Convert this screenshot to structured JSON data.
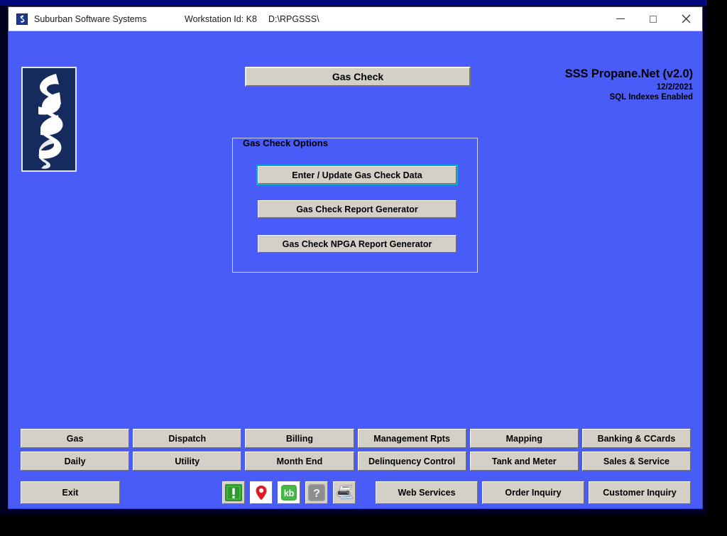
{
  "window": {
    "title": "Suburban Software Systems",
    "workstation": "Workstation Id: K8",
    "path": "D:\\RPGSSS\\",
    "controls": {
      "minimize": "minimize-button",
      "maximize": "maximize-button",
      "close": "close-button"
    }
  },
  "header": {
    "screen_title": "Gas Check",
    "app_name": "SSS Propane.Net (v2.0)",
    "date": "12/2/2021",
    "status": "SQL Indexes Enabled",
    "logo_alt": "Suburban Software Systems logo"
  },
  "group": {
    "legend": "Gas Check Options",
    "buttons": [
      {
        "label": "Enter / Update Gas Check Data",
        "focused": true
      },
      {
        "label": "Gas Check Report Generator",
        "focused": false
      },
      {
        "label": "Gas Check NPGA Report Generator",
        "focused": false
      }
    ]
  },
  "nav": {
    "row1": [
      "Gas",
      "Dispatch",
      "Billing",
      "Management Rpts",
      "Mapping",
      "Banking & CCards"
    ],
    "row2": [
      "Daily",
      "Utility",
      "Month End",
      "Delinquency Control",
      "Tank and Meter",
      "Sales & Service"
    ],
    "exit": "Exit",
    "tray": [
      {
        "name": "alert-icon",
        "text": "!"
      },
      {
        "name": "map-pin-icon",
        "text": ""
      },
      {
        "name": "knowledge-base-icon",
        "text": "kb"
      },
      {
        "name": "help-icon",
        "text": "?"
      },
      {
        "name": "printer-icon",
        "text": ""
      }
    ],
    "actions": [
      "Web Services",
      "Order Inquiry",
      "Customer Inquiry"
    ]
  },
  "colors": {
    "app_background": "#4a5cf7",
    "button_face": "#d4d0c8",
    "focus_ring": "#00b0d8",
    "logo_navy": "#152b5e",
    "desktop_navy": "#000a7a"
  }
}
